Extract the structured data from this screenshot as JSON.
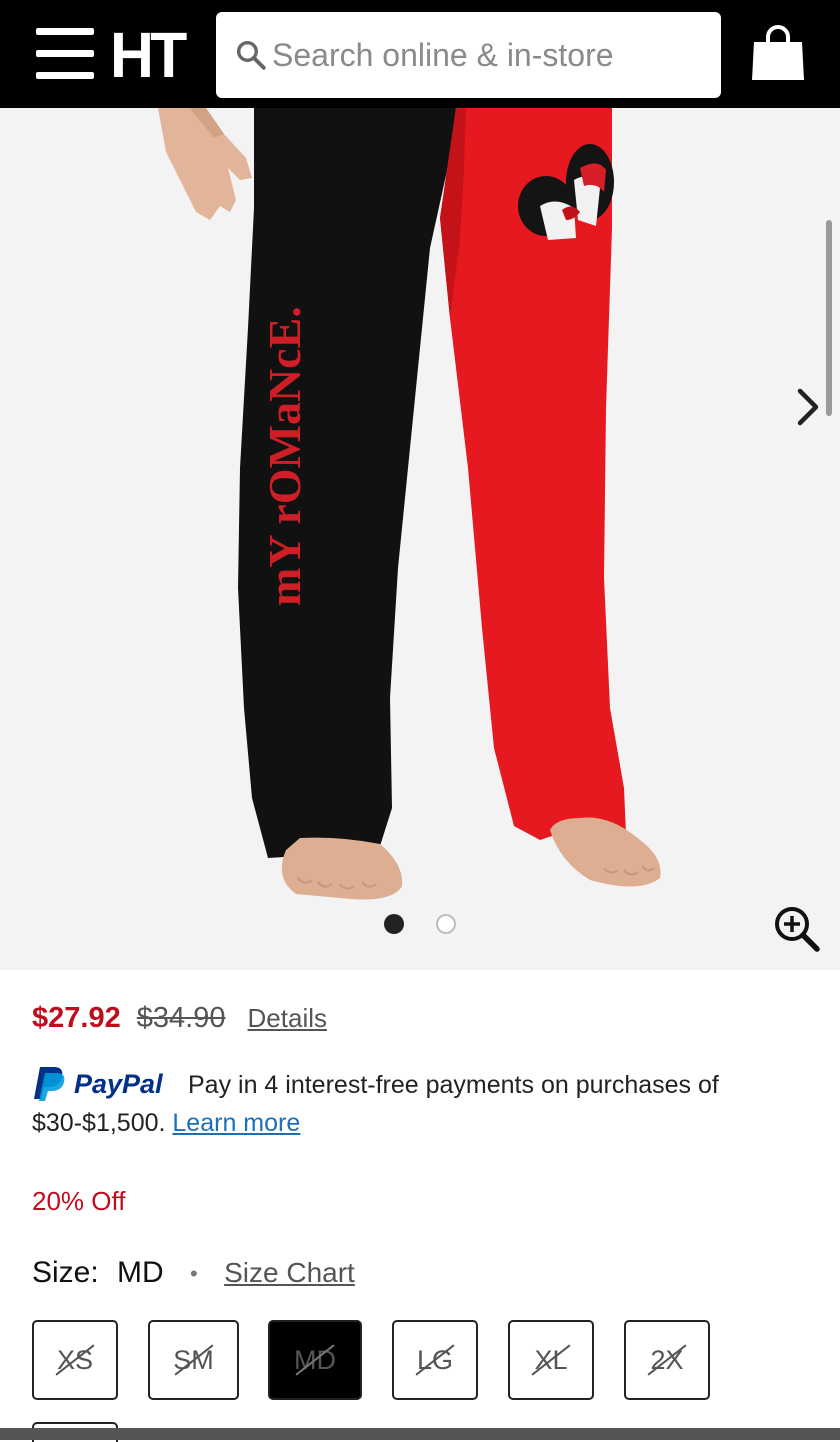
{
  "header": {
    "logo_text": "HT",
    "search_placeholder": "Search online & in-store",
    "icons": [
      "hamburger-menu-icon",
      "search-icon",
      "shopping-bag-icon"
    ]
  },
  "gallery": {
    "image_alt": "Two-tone black and red lounge pants with red vertical lettering and a kissing couple graphic",
    "pant_print_text": "mY rOMaNcE.",
    "slides": [
      {
        "active": true
      },
      {
        "active": false
      }
    ],
    "icons": [
      "chevron-right-icon",
      "zoom-in-icon"
    ]
  },
  "pricing": {
    "sale_price": "$27.92",
    "original_price": "$34.90",
    "details_label": "Details"
  },
  "paypal": {
    "logo_text": "PayPal",
    "message": "Pay in 4 interest-free payments on purchases of $30-$1,500.",
    "learn_more_label": "Learn more"
  },
  "promo": {
    "discount_text": "20% Off"
  },
  "size": {
    "label": "Size:",
    "selected_value": "MD",
    "chart_label": "Size Chart",
    "options": [
      {
        "label": "XS",
        "available": false,
        "selected": false
      },
      {
        "label": "SM",
        "available": false,
        "selected": false
      },
      {
        "label": "MD",
        "available": false,
        "selected": true
      },
      {
        "label": "LG",
        "available": false,
        "selected": false
      },
      {
        "label": "XL",
        "available": false,
        "selected": false
      },
      {
        "label": "2X",
        "available": false,
        "selected": false
      }
    ]
  },
  "colors": {
    "header_bg": "#000000",
    "sale_red": "#c00d1e",
    "link_blue": "#1a6fb8",
    "paypal_dark": "#003087",
    "paypal_light": "#009cde"
  }
}
